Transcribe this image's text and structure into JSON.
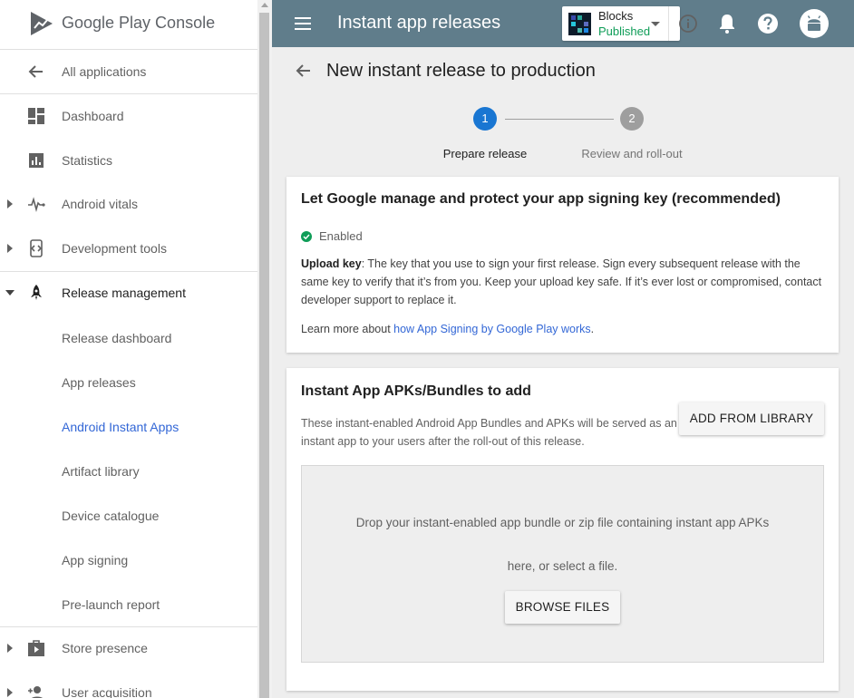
{
  "logo": {
    "text": "Google Play Console"
  },
  "sidebar": {
    "items": [
      {
        "label": "All applications"
      },
      {
        "label": "Dashboard"
      },
      {
        "label": "Statistics"
      },
      {
        "label": "Android vitals"
      },
      {
        "label": "Development tools"
      },
      {
        "label": "Release management"
      },
      {
        "label": "Release dashboard"
      },
      {
        "label": "App releases"
      },
      {
        "label": "Android Instant Apps"
      },
      {
        "label": "Artifact library"
      },
      {
        "label": "Device catalogue"
      },
      {
        "label": "App signing"
      },
      {
        "label": "Pre-launch report"
      },
      {
        "label": "Store presence"
      },
      {
        "label": "User acquisition"
      }
    ]
  },
  "header": {
    "title": "Instant app releases",
    "app_name": "Blocks",
    "app_status": "Published"
  },
  "page": {
    "title": "New instant release to production",
    "steps": [
      {
        "num": "1",
        "label": "Prepare release"
      },
      {
        "num": "2",
        "label": "Review and roll-out"
      }
    ]
  },
  "signing_card": {
    "title": "Let Google manage and protect your app signing key (recommended)",
    "enabled_label": "Enabled",
    "upload_key_term": "Upload key",
    "upload_key_desc": ": The key that you use to sign your first release. Sign every subsequent release with the same key to verify that it’s from you. Keep your upload key safe. If it’s ever lost or compromised, contact developer support to replace it.",
    "learn_more_prefix": "Learn more about ",
    "learn_more_link": "how App Signing by Google Play works",
    "learn_more_suffix": "."
  },
  "apk_card": {
    "title": "Instant App APKs/Bundles to add",
    "description": "These instant-enabled Android App Bundles and APKs will be served as an instant app to your users after the roll-out of this release.",
    "add_from_library_label": "ADD FROM LIBRARY",
    "dropzone_line1": "Drop your instant-enabled app bundle or zip file containing instant app APKs",
    "dropzone_line2": "here, or select a file.",
    "browse_label": "BROWSE FILES"
  },
  "colors": {
    "topbar": "#607d8b",
    "accent_blue": "#3367d6",
    "step_active": "#1976d2",
    "step_inactive": "#9e9e9e",
    "published_green": "#0f9d58"
  }
}
